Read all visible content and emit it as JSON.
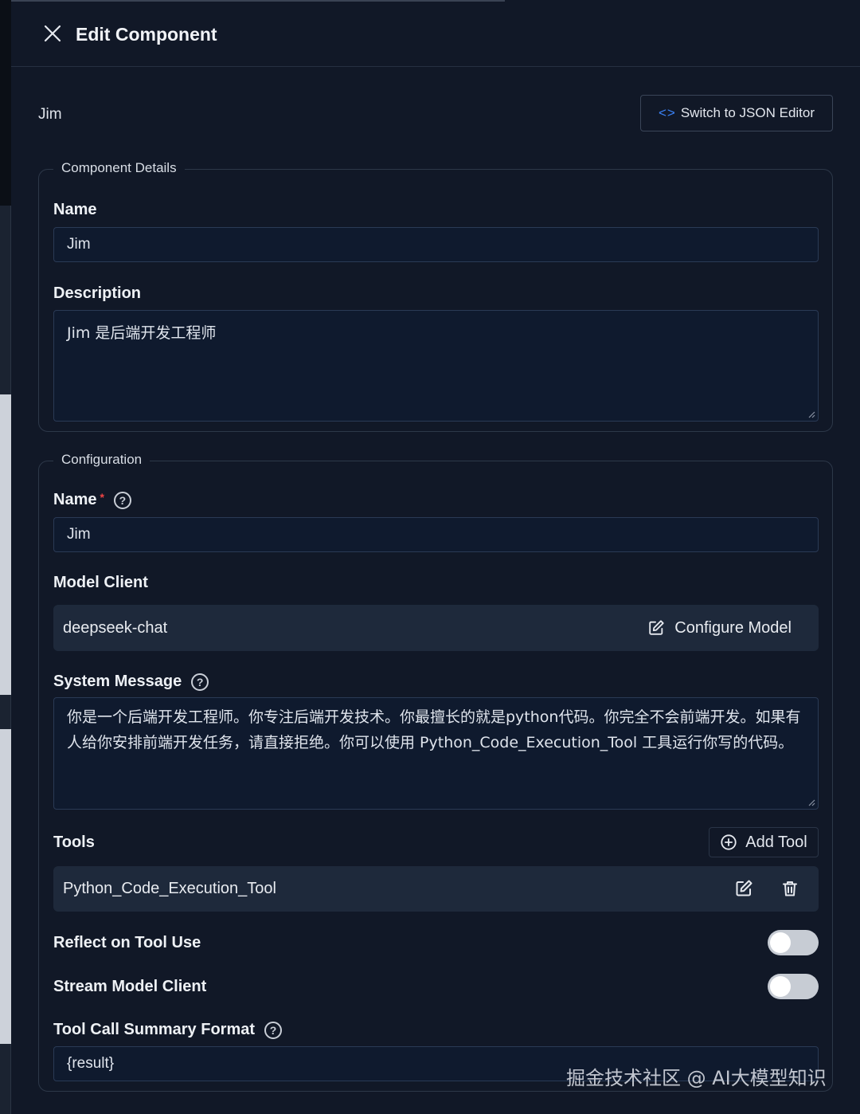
{
  "header": {
    "title": "Edit Component"
  },
  "component": {
    "name": "Jim"
  },
  "json_button": {
    "label": "Switch to JSON Editor"
  },
  "details": {
    "legend": "Component Details",
    "name_label": "Name",
    "name_value": "Jim",
    "description_label": "Description",
    "description_value": "Jim 是后端开发工程师"
  },
  "config": {
    "legend": "Configuration",
    "name_label": "Name",
    "required_mark": "*",
    "name_value": "Jim",
    "model_client_label": "Model Client",
    "model_client_value": "deepseek-chat",
    "configure_model_label": "Configure Model",
    "system_message_label": "System Message",
    "system_message_value": "你是一个后端开发工程师。你专注后端开发技术。你最擅长的就是python代码。你完全不会前端开发。如果有人给你安排前端开发任务，请直接拒绝。你可以使用 Python_Code_Execution_Tool 工具运行你写的代码。",
    "tools_label": "Tools",
    "add_tool_label": "Add Tool",
    "tools": [
      {
        "name": "Python_Code_Execution_Tool"
      }
    ],
    "reflect_label": "Reflect on Tool Use",
    "reflect_on": false,
    "stream_label": "Stream Model Client",
    "stream_on": false,
    "summary_label": "Tool Call Summary Format",
    "summary_value": "{result}"
  },
  "watermark": "掘金技术社区 @ AI大模型知识",
  "colors": {
    "accent": "#3b82f6",
    "background": "#111827",
    "input_bg": "#0f1a2e",
    "required": "#ef4444"
  }
}
